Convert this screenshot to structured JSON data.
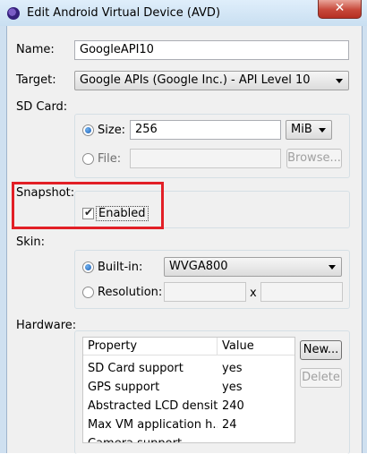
{
  "window": {
    "title": "Edit Android Virtual Device (AVD)",
    "close_label": "✕"
  },
  "name": {
    "label": "Name:",
    "value": "GoogleAPI10"
  },
  "target": {
    "label": "Target:",
    "value": "Google APIs (Google Inc.) - API Level 10"
  },
  "sdcard": {
    "label": "SD Card:",
    "size_label": "Size:",
    "size_value": "256",
    "size_unit": "MiB",
    "file_label": "File:",
    "file_value": "",
    "browse_label": "Browse..."
  },
  "snapshot": {
    "label": "Snapshot:",
    "enabled_label": "Enabled",
    "checked": true
  },
  "skin": {
    "label": "Skin:",
    "builtin_label": "Built-in:",
    "builtin_value": "WVGA800",
    "resolution_label": "Resolution:",
    "res_x": "x"
  },
  "hardware": {
    "label": "Hardware:",
    "columns": [
      "Property",
      "Value"
    ],
    "rows": [
      {
        "property": "SD Card support",
        "value": "yes"
      },
      {
        "property": "GPS support",
        "value": "yes"
      },
      {
        "property": "Abstracted LCD density",
        "value": "240"
      },
      {
        "property": "Max VM application h...",
        "value": "24"
      },
      {
        "property": "Camera support",
        "value": ""
      }
    ],
    "new_button": "New...",
    "delete_button": "Delete"
  },
  "colors": {
    "highlight_box": "#e21f26",
    "close_button": "#c7483a"
  }
}
